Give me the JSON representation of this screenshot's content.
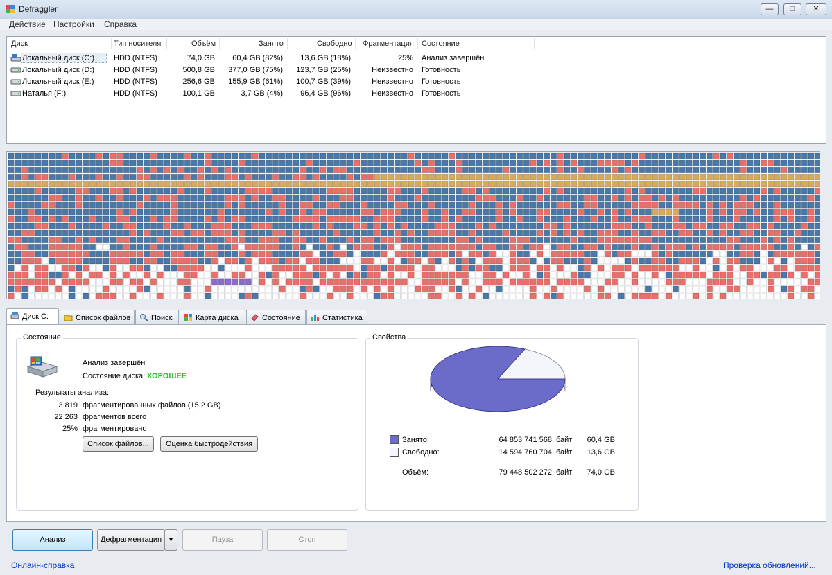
{
  "window": {
    "title": "Defraggler",
    "min_glyph": "—",
    "max_glyph": "□",
    "close_glyph": "✕"
  },
  "menu": [
    "Действие",
    "Настройки",
    "Справка"
  ],
  "drive_table": {
    "columns": [
      "Диск",
      "Тип носителя",
      "Объём",
      "Занято",
      "Свободно",
      "Фрагментация",
      "Состояние"
    ],
    "rows": [
      {
        "name": "Локальный диск (C:)",
        "type": "HDD (NTFS)",
        "size": "74,0 GB",
        "used": "60,4 GB (82%)",
        "free": "13,6 GB (18%)",
        "frag": "25%",
        "status": "Анализ завершён",
        "selected": true
      },
      {
        "name": "Локальный диск (D:)",
        "type": "HDD (NTFS)",
        "size": "500,8 GB",
        "used": "377,0 GB (75%)",
        "free": "123,7 GB (25%)",
        "frag": "Неизвестно",
        "status": "Готовность",
        "selected": false
      },
      {
        "name": "Локальный диск (E:)",
        "type": "HDD (NTFS)",
        "size": "256,6 GB",
        "used": "155,9 GB (61%)",
        "free": "100,7 GB (39%)",
        "frag": "Неизвестно",
        "status": "Готовность",
        "selected": false
      },
      {
        "name": "Наталья (F:)",
        "type": "HDD (NTFS)",
        "size": "100,1 GB",
        "used": "3,7 GB (4%)",
        "free": "96,4 GB (96%)",
        "frag": "Неизвестно",
        "status": "Готовность",
        "selected": false
      }
    ]
  },
  "disk_map": {
    "colors": {
      "used": "#4a78a8",
      "fragmented": "#e8706a",
      "free": "#ffffff",
      "system": "#d8aa5c",
      "mft": "#8a6cc8"
    }
  },
  "tabs": [
    "Диск C:",
    "Список файлов",
    "Поиск",
    "Карта диска",
    "Состояние",
    "Статистика"
  ],
  "status_group": {
    "title": "Состояние",
    "analysis": "Анализ завершён",
    "disk_state_label": "Состояние диска:",
    "disk_state_value": "ХОРОШЕЕ",
    "results_title": "Результаты анализа:",
    "results": [
      {
        "value": "3 819",
        "label": "фрагментированных файлов (15,2 GB)"
      },
      {
        "value": "22 263",
        "label": "фрагментов всего"
      },
      {
        "value": "25%",
        "label": "фрагментировано"
      }
    ],
    "file_list_button": "Список файлов...",
    "benchmark_button": "Оценка быстродействия"
  },
  "properties_group": {
    "title": "Свойства",
    "used_fraction": 0.816,
    "rows": [
      {
        "label": "Занято:",
        "bytes": "64 853 741 568",
        "unit": "байт",
        "gb": "60,4 GB"
      },
      {
        "label": "Свободно:",
        "bytes": "14 594 760 704",
        "unit": "байт",
        "gb": "13,6 GB"
      },
      {
        "label": "Объём:",
        "bytes": "79 448 502 272",
        "unit": "байт",
        "gb": "74,0 GB"
      }
    ],
    "colors": {
      "used": "#6b6bc9",
      "free": "#f4f5fb"
    }
  },
  "bottom": {
    "analyze": "Анализ",
    "defrag": "Дефрагментация",
    "defrag_arrow": "▾",
    "pause": "Пауза",
    "stop": "Стоп",
    "help_link": "Онлайн-справка",
    "update_link": "Проверка обновлений..."
  }
}
